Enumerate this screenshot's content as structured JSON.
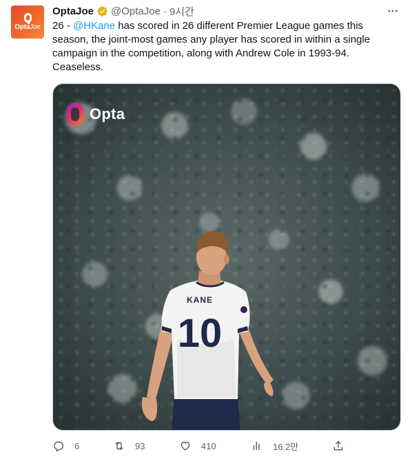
{
  "author": {
    "display_name": "OptaJoe",
    "handle": "@OptaJoe",
    "separator": "·",
    "time": "9시간",
    "verified": true,
    "avatar_text_bold": "Opta",
    "avatar_text_light": "Joe"
  },
  "tweet": {
    "text_prefix": "26 - ",
    "mention": "@HKane",
    "text_rest": " has scored in 26 different Premier League games this season, the joint-most games any player has scored in within a single campaign in the competition, along with Andrew Cole in 1993-94. Ceaseless."
  },
  "media": {
    "brand_text": "Opta",
    "shirt_name": "KANE",
    "shirt_number": "10"
  },
  "actions": {
    "replies": "6",
    "retweets": "93",
    "likes": "410",
    "views": "16.2만"
  },
  "colors": {
    "accent": "#1d9bf0",
    "muted": "#536471",
    "verified_badge": "#e2b719",
    "avatar_orange": "#e8462b"
  },
  "icons": {
    "more": "more-dots-icon",
    "reply": "reply-icon",
    "retweet": "retweet-icon",
    "like": "heart-icon",
    "views": "views-bars-icon",
    "share": "share-icon",
    "verified": "verified-badge-icon"
  }
}
